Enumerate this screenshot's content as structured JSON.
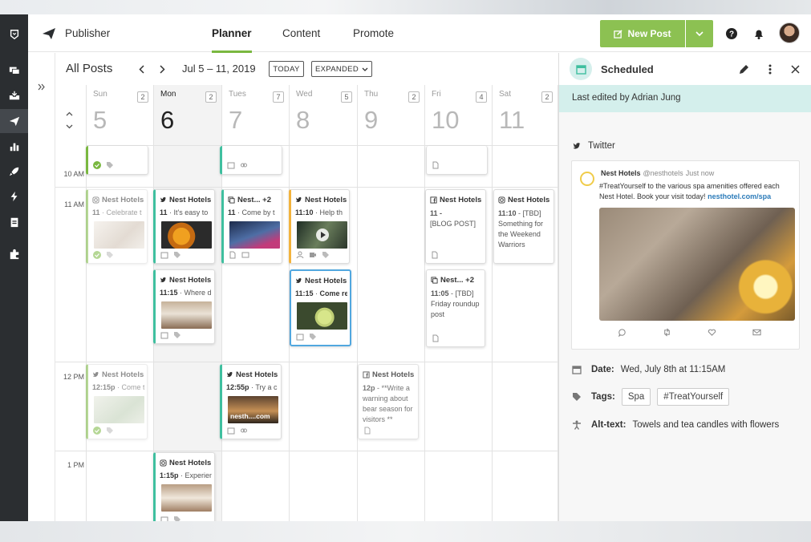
{
  "app": {
    "name": "Publisher"
  },
  "nav": {
    "tabs": [
      {
        "label": "Planner"
      },
      {
        "label": "Content"
      },
      {
        "label": "Promote"
      }
    ]
  },
  "actions": {
    "new_post": "New Post"
  },
  "calendar": {
    "title": "All Posts",
    "date_range": "Jul 5 – 11, 2019",
    "today_button": "TODAY",
    "view_button": "EXPANDED",
    "days": [
      {
        "name": "Sun",
        "num": "5",
        "count": "2"
      },
      {
        "name": "Mon",
        "num": "6",
        "count": "2"
      },
      {
        "name": "Tues",
        "num": "7",
        "count": "7"
      },
      {
        "name": "Wed",
        "num": "8",
        "count": "5"
      },
      {
        "name": "Thu",
        "num": "9",
        "count": "2"
      },
      {
        "name": "Fri",
        "num": "10",
        "count": "4"
      },
      {
        "name": "Sat",
        "num": "11",
        "count": "2"
      }
    ],
    "times": [
      "10 AM",
      "11 AM",
      "12 PM",
      "1 PM"
    ],
    "posts": [
      {
        "network": "instagram",
        "account": "Nest Hotels",
        "time": "11",
        "text": "Celebrate t"
      },
      {
        "network": "twitter",
        "account": "Nest Hotels",
        "time": "11",
        "text": "It's easy to"
      },
      {
        "network": "multi",
        "account": "Nest... +2",
        "time": "11",
        "text": "Come by t"
      },
      {
        "network": "twitter",
        "account": "Nest Hotels",
        "time": "11:10",
        "text": "Help th"
      },
      {
        "network": "facebook",
        "account": "Nest Hotels",
        "time": "11 -",
        "text": "[BLOG POST]"
      },
      {
        "network": "instagram",
        "account": "Nest Hotels",
        "time": "11:10",
        "text": "- [TBD] Something for the Weekend Warriors"
      },
      {
        "network": "twitter",
        "account": "Nest Hotels",
        "time": "11:15",
        "text": "Where d"
      },
      {
        "network": "twitter",
        "account": "Nest Hotels",
        "time": "11:15",
        "text": "Come re"
      },
      {
        "network": "multi",
        "account": "Nest... +2",
        "time": "11:05",
        "text": "- [TBD] Friday roundup post"
      },
      {
        "network": "twitter",
        "account": "Nest Hotels",
        "time": "12:15p",
        "text": "Come t"
      },
      {
        "network": "twitter",
        "account": "Nest Hotels",
        "time": "12:55p",
        "text": "Try a c",
        "image_caption": "nesth....com"
      },
      {
        "network": "facebook",
        "account": "Nest Hotels",
        "time": "12p",
        "text": "- **Write a warning about bear season for visitors **"
      },
      {
        "network": "instagram",
        "account": "Nest Hotels",
        "time": "1:15p",
        "text": "Experien"
      }
    ]
  },
  "panel": {
    "status": "Scheduled",
    "edited": "Last edited by Adrian Jung",
    "network": "Twitter",
    "tweet": {
      "name": "Nest Hotels",
      "handle": "@nesthotels",
      "when": "Just now",
      "body": "#TreatYourself to the various spa amenities offered each Nest Hotel. Book your visit today!",
      "link": "nesthotel.com/spa"
    },
    "date_label": "Date:",
    "date_value": "Wed, July 8th at 11:15AM",
    "tags_label": "Tags:",
    "tags": [
      "Spa",
      "#TreatYourself"
    ],
    "alt_label": "Alt-text:",
    "alt_value": "Towels and tea candles with flowers"
  },
  "colors": {
    "accent": "#8cc152",
    "rail": "#2b2e31",
    "scheduled": "#d4efec",
    "selected": "#51a7df"
  }
}
